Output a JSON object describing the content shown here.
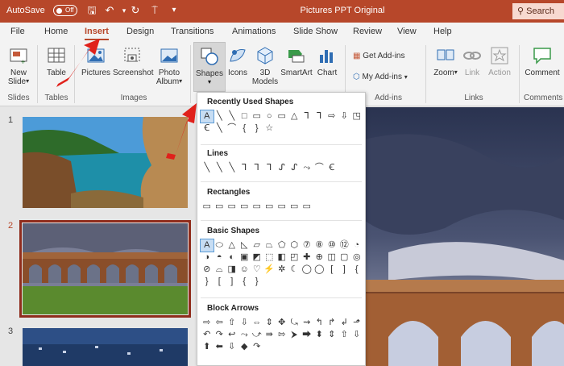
{
  "titlebar": {
    "autosave_label": "AutoSave",
    "toggle_label": "Off",
    "doc_title": "Pictures PPT Original",
    "search_label": "Search"
  },
  "tabs": [
    "File",
    "Home",
    "Insert",
    "Design",
    "Transitions",
    "Animations",
    "Slide Show",
    "Review",
    "View",
    "Help"
  ],
  "active_tab": "Insert",
  "ribbon": {
    "new_slide": [
      "New",
      "Slide"
    ],
    "table": "Table",
    "pictures": "Pictures",
    "screenshot": "Screenshot",
    "photo_album": [
      "Photo",
      "Album"
    ],
    "shapes": "Shapes",
    "icons": "Icons",
    "models": [
      "3D",
      "Models"
    ],
    "smartart": "SmartArt",
    "chart": "Chart",
    "get_addins": "Get Add-ins",
    "my_addins": "My Add-ins",
    "zoom": "Zoom",
    "link": "Link",
    "action": "Action",
    "comment": "Comment",
    "groups": {
      "slides": "Slides",
      "tables": "Tables",
      "images": "Images",
      "addins": "Add-ins",
      "links": "Links",
      "comments": "Comments"
    }
  },
  "slides": {
    "numbers": [
      "1",
      "2",
      "3"
    ]
  },
  "shapes_menu": {
    "sections": [
      "Recently Used Shapes",
      "Lines",
      "Rectangles",
      "Basic Shapes",
      "Block Arrows"
    ],
    "recent": [
      "A",
      "╲",
      "╲",
      "□",
      "▭",
      "○",
      "▭",
      "△",
      "⅂",
      "⅂",
      "⇨",
      "⇩",
      "◳",
      "Ꞓ",
      "╲",
      "⌒",
      "{",
      "}",
      "☆"
    ],
    "lines": [
      "╲",
      "╲",
      "╲",
      "⅂",
      "⅂",
      "⅂",
      "ᔑ",
      "ᔑ",
      "⤳",
      "⌒",
      "Ꞓ"
    ],
    "rectangles": [
      "▭",
      "▭",
      "▭",
      "▭",
      "▭",
      "▭",
      "▭",
      "▭",
      "▭"
    ],
    "basic": [
      "A",
      "⬭",
      "△",
      "◺",
      "▱",
      "⏢",
      "⬠",
      "⬡",
      "⑦",
      "⑧",
      "⑩",
      "⑫",
      "◔",
      "◑",
      "◓",
      "◐",
      "▣",
      "◩",
      "⬚",
      "◧",
      "◰",
      "✚",
      "⊕",
      "◫",
      "▢",
      "◎",
      "⊘",
      "⌓",
      "◨",
      "☺",
      "♡",
      "⚡",
      "✲",
      "☾",
      "◯",
      "◯",
      "[",
      "]",
      "{",
      "}",
      "[",
      "]",
      "{",
      "}"
    ],
    "block": [
      "⇨",
      "⇦",
      "⇧",
      "⇩",
      "⇔",
      "⇕",
      "✥",
      "⤿",
      "⇝",
      "↰",
      "↱",
      "↲",
      "⬏",
      "↶",
      "↷",
      "↩",
      "⤳",
      "⤻",
      "⇛",
      "⇰",
      "⮞",
      "⮕",
      "⬍",
      "⇕",
      "⇧",
      "⇩",
      "⬆",
      "⬅",
      "⇩",
      "◆",
      "↷"
    ]
  },
  "colors": {
    "accent": "#b7472a",
    "selection_outline": "#8f2c1c",
    "arrow": "#e0211b"
  }
}
